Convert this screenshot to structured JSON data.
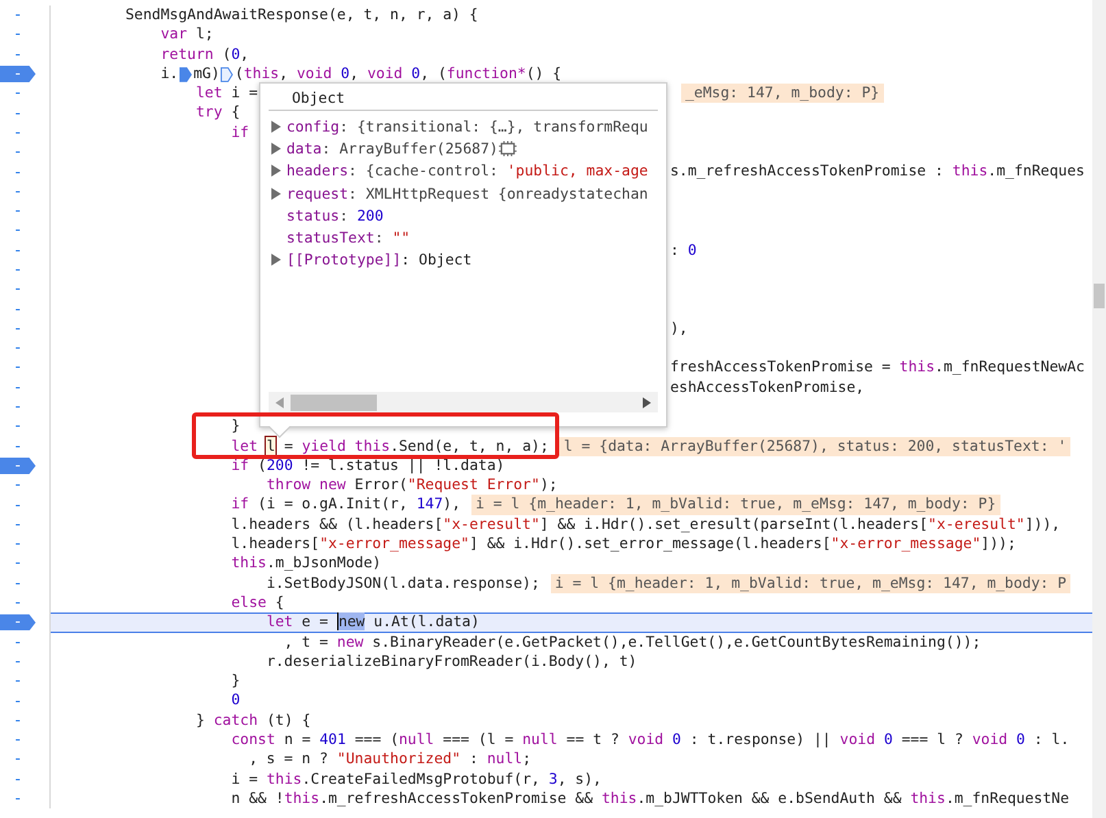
{
  "lines": [
    {
      "gutter": "-",
      "breakpoint": false,
      "current": false,
      "pieces": [
        {
          "kind": "code",
          "tokens": [
            "        SendMsgAndAwaitResponse(e, t, n, r, a) {"
          ]
        }
      ]
    },
    {
      "gutter": "-",
      "breakpoint": false,
      "current": false,
      "pieces": [
        {
          "kind": "code",
          "tokens": [
            {
              "text": "            var",
              "kind": "kw"
            },
            " l;"
          ]
        }
      ]
    },
    {
      "gutter": "-",
      "breakpoint": false,
      "current": false,
      "pieces": [
        {
          "kind": "code",
          "tokens": [
            {
              "text": "            return",
              "kind": "kw"
            },
            " (",
            {
              "text": "0",
              "kind": "num"
            },
            ","
          ]
        }
      ]
    },
    {
      "gutter": "-",
      "breakpoint": true,
      "current": false,
      "pieces": [
        {
          "kind": "code",
          "tokens": [
            "            i."
          ]
        },
        {
          "kind": "mark-solid"
        },
        {
          "kind": "code",
          "tokens": [
            "mG)"
          ]
        },
        {
          "kind": "mark-outline"
        },
        {
          "kind": "code",
          "tokens": [
            "(",
            {
              "text": "this",
              "kind": "kw"
            },
            ", ",
            {
              "text": "void ",
              "kind": "kw"
            },
            {
              "text": "0",
              "kind": "num"
            },
            ", ",
            {
              "text": "void ",
              "kind": "kw"
            },
            {
              "text": "0",
              "kind": "num"
            },
            ", (",
            {
              "text": "function*",
              "kind": "kw"
            },
            "() {"
          ]
        }
      ]
    },
    {
      "gutter": "-",
      "breakpoint": false,
      "current": false,
      "pieces": [
        {
          "kind": "code",
          "tokens": [
            {
              "text": "                let",
              "kind": "kw"
            },
            " i ="
          ]
        }
      ],
      "right": [
        {
          "kind": "value",
          "text": "_eMsg: 147, m_body: P}"
        }
      ]
    },
    {
      "gutter": "-",
      "breakpoint": false,
      "current": false,
      "pieces": [
        {
          "kind": "code",
          "tokens": [
            {
              "text": "                try",
              "kind": "kw"
            },
            " {"
          ]
        }
      ]
    },
    {
      "gutter": "-",
      "breakpoint": false,
      "current": false,
      "pieces": [
        {
          "kind": "code",
          "tokens": [
            {
              "text": "                    if",
              "kind": "kw"
            }
          ]
        }
      ]
    },
    {
      "gutter": "-",
      "breakpoint": false,
      "current": false
    },
    {
      "gutter": "-",
      "breakpoint": false,
      "current": false,
      "right": [
        {
          "kind": "code",
          "tokens": [
            "s.m_refreshAccessTokenPromise : ",
            {
              "text": "this",
              "kind": "kw"
            },
            ".m_fnReques"
          ]
        }
      ]
    },
    {
      "gutter": "-",
      "breakpoint": false,
      "current": false
    },
    {
      "gutter": "-",
      "breakpoint": false,
      "current": false
    },
    {
      "gutter": "-",
      "breakpoint": false,
      "current": false
    },
    {
      "gutter": "-",
      "breakpoint": false,
      "current": false,
      "right": [
        {
          "kind": "code",
          "tokens": [
            ": ",
            {
              "text": "0",
              "kind": "num"
            }
          ]
        }
      ]
    },
    {
      "gutter": "-",
      "breakpoint": false,
      "current": false
    },
    {
      "gutter": "-",
      "breakpoint": false,
      "current": false
    },
    {
      "gutter": "-",
      "breakpoint": false,
      "current": false
    },
    {
      "gutter": "-",
      "breakpoint": false,
      "current": false,
      "right": [
        {
          "kind": "code",
          "tokens": [
            "),"
          ]
        }
      ]
    },
    {
      "gutter": "-",
      "breakpoint": false,
      "current": false
    },
    {
      "gutter": "-",
      "breakpoint": false,
      "current": false,
      "right": [
        {
          "kind": "code",
          "tokens": [
            "freshAccessTokenPromise = ",
            {
              "text": "this",
              "kind": "kw"
            },
            ".m_fnRequestNewAc"
          ]
        }
      ]
    },
    {
      "gutter": "-",
      "breakpoint": false,
      "current": false,
      "right": [
        {
          "kind": "code",
          "tokens": [
            "eshAccessTokenPromise,"
          ]
        }
      ]
    },
    {
      "gutter": "-",
      "breakpoint": false,
      "current": false
    },
    {
      "gutter": "-",
      "breakpoint": false,
      "current": false,
      "pieces": [
        {
          "kind": "code",
          "tokens": [
            "                    }"
          ]
        }
      ]
    },
    {
      "gutter": "-",
      "breakpoint": false,
      "current": false,
      "pieces": [
        {
          "kind": "code",
          "tokens": [
            {
              "text": "                    let ",
              "kind": "kw"
            },
            {
              "text": "l",
              "kind": "boxed"
            },
            " = ",
            {
              "text": "yield this",
              "kind": "kw"
            },
            ".Send(e, t, n, a);"
          ]
        },
        {
          "kind": "value",
          "text": "l = {data: ArrayBuffer(25687), status: 200, statusText: '"
        }
      ]
    },
    {
      "gutter": "-",
      "breakpoint": true,
      "current": false,
      "pieces": [
        {
          "kind": "code",
          "tokens": [
            {
              "text": "                    if",
              "kind": "kw"
            },
            " (",
            {
              "text": "200",
              "kind": "num"
            },
            " != l.status || !l.data)"
          ]
        }
      ]
    },
    {
      "gutter": "-",
      "breakpoint": false,
      "current": false,
      "pieces": [
        {
          "kind": "code",
          "tokens": [
            {
              "text": "                        throw new",
              "kind": "kw"
            },
            " Error(",
            {
              "text": "\"Request Error\"",
              "kind": "str"
            },
            ");"
          ]
        }
      ]
    },
    {
      "gutter": "-",
      "breakpoint": false,
      "current": false,
      "pieces": [
        {
          "kind": "code",
          "tokens": [
            {
              "text": "                    if",
              "kind": "kw"
            },
            " (i = o.gA.Init(r, ",
            {
              "text": "147",
              "kind": "num"
            },
            "),"
          ]
        },
        {
          "kind": "value",
          "text": "i = l {m_header: 1, m_bValid: true, m_eMsg: 147, m_body: P}"
        }
      ]
    },
    {
      "gutter": "-",
      "breakpoint": false,
      "current": false,
      "pieces": [
        {
          "kind": "code",
          "tokens": [
            "                    l.headers && (l.headers[",
            {
              "text": "\"x-eresult\"",
              "kind": "str"
            },
            "] && i.Hdr().set_eresult(parseInt(l.headers[",
            {
              "text": "\"x-eresult\"",
              "kind": "str"
            },
            "])),"
          ]
        }
      ]
    },
    {
      "gutter": "-",
      "breakpoint": false,
      "current": false,
      "pieces": [
        {
          "kind": "code",
          "tokens": [
            "                    l.headers[",
            {
              "text": "\"x-error_message\"",
              "kind": "str"
            },
            "] && i.Hdr().set_error_message(l.headers[",
            {
              "text": "\"x-error_message\"",
              "kind": "str"
            },
            "]));"
          ]
        }
      ]
    },
    {
      "gutter": "-",
      "breakpoint": false,
      "current": false,
      "pieces": [
        {
          "kind": "code",
          "tokens": [
            {
              "text": "                    this",
              "kind": "kw"
            },
            ".m_bJsonMode)"
          ]
        }
      ]
    },
    {
      "gutter": "-",
      "breakpoint": false,
      "current": false,
      "pieces": [
        {
          "kind": "code",
          "tokens": [
            "                        i.SetBodyJSON(l.data.response);"
          ]
        },
        {
          "kind": "value",
          "text": "i = l {m_header: 1, m_bValid: true, m_eMsg: 147, m_body: P"
        }
      ]
    },
    {
      "gutter": "-",
      "breakpoint": false,
      "current": false,
      "pieces": [
        {
          "kind": "code",
          "tokens": [
            {
              "text": "                    else",
              "kind": "kw"
            },
            " {"
          ]
        }
      ]
    },
    {
      "gutter": "-",
      "breakpoint": true,
      "current": true,
      "pieces": [
        {
          "kind": "code",
          "tokens": [
            {
              "text": "                        let",
              "kind": "kw"
            },
            " e = ",
            {
              "text": "new",
              "kind": "sel"
            },
            " u.At(l.data)"
          ]
        }
      ]
    },
    {
      "gutter": "-",
      "breakpoint": false,
      "current": false,
      "pieces": [
        {
          "kind": "code",
          "tokens": [
            "                          , t = ",
            {
              "text": "new",
              "kind": "kw"
            },
            " s.BinaryReader(e.GetPacket(),e.TellGet(),e.GetCountBytesRemaining());"
          ]
        }
      ]
    },
    {
      "gutter": "-",
      "breakpoint": false,
      "current": false,
      "pieces": [
        {
          "kind": "code",
          "tokens": [
            "                        r.deserializeBinaryFromReader(i.Body(), t)"
          ]
        }
      ]
    },
    {
      "gutter": "-",
      "breakpoint": false,
      "current": false,
      "pieces": [
        {
          "kind": "code",
          "tokens": [
            "                    }"
          ]
        }
      ]
    },
    {
      "gutter": "-",
      "breakpoint": false,
      "current": false,
      "pieces": [
        {
          "kind": "code",
          "tokens": [
            {
              "text": "                    0",
              "kind": "num"
            }
          ]
        }
      ]
    },
    {
      "gutter": "-",
      "breakpoint": false,
      "current": false,
      "pieces": [
        {
          "kind": "code",
          "tokens": [
            "                } ",
            {
              "text": "catch",
              "kind": "kw"
            },
            " (t) {"
          ]
        }
      ]
    },
    {
      "gutter": "-",
      "breakpoint": false,
      "current": false,
      "pieces": [
        {
          "kind": "code",
          "tokens": [
            {
              "text": "                    const",
              "kind": "kw"
            },
            " n = ",
            {
              "text": "401",
              "kind": "num"
            },
            " === (",
            {
              "text": "null",
              "kind": "kw"
            },
            " === (l = ",
            {
              "text": "null",
              "kind": "kw"
            },
            " == t ? ",
            {
              "text": "void ",
              "kind": "kw"
            },
            {
              "text": "0",
              "kind": "num"
            },
            " : t.response) || ",
            {
              "text": "void ",
              "kind": "kw"
            },
            {
              "text": "0",
              "kind": "num"
            },
            " === l ? ",
            {
              "text": "void ",
              "kind": "kw"
            },
            {
              "text": "0",
              "kind": "num"
            },
            " : l."
          ]
        }
      ]
    },
    {
      "gutter": "-",
      "breakpoint": false,
      "current": false,
      "pieces": [
        {
          "kind": "code",
          "tokens": [
            "                      , s = n ? ",
            {
              "text": "\"Unauthorized\"",
              "kind": "str"
            },
            " : ",
            {
              "text": "null",
              "kind": "kw"
            },
            ";"
          ]
        }
      ]
    },
    {
      "gutter": "-",
      "breakpoint": false,
      "current": false,
      "pieces": [
        {
          "kind": "code",
          "tokens": [
            "                    i = ",
            {
              "text": "this",
              "kind": "kw"
            },
            ".CreateFailedMsgProtobuf(r, ",
            {
              "text": "3",
              "kind": "num"
            },
            ", s),"
          ]
        }
      ]
    },
    {
      "gutter": "-",
      "breakpoint": false,
      "current": false,
      "pieces": [
        {
          "kind": "code",
          "tokens": [
            "                    n && !",
            {
              "text": "this",
              "kind": "kw"
            },
            ".m_refreshAccessTokenPromise && ",
            {
              "text": "this",
              "kind": "kw"
            },
            ".m_bJWTToken && e.bSendAuth && ",
            {
              "text": "this",
              "kind": "kw"
            },
            ".m_fnRequestNe"
          ]
        }
      ]
    }
  ],
  "popover": {
    "title": "Object",
    "properties": [
      {
        "kind": "object",
        "expandable": true,
        "key": "config",
        "value": [
          {
            "text": ": {transitional: {…}, transformRequ",
            "kind": "obj"
          }
        ]
      },
      {
        "kind": "buffer",
        "expandable": true,
        "key": "data",
        "value": [
          {
            "text": ": ArrayBuffer(25687)",
            "kind": "obj"
          }
        ]
      },
      {
        "kind": "object",
        "expandable": true,
        "key": "headers",
        "value": [
          {
            "text": ": {cache-control: ",
            "kind": "obj"
          },
          {
            "text": "'public, max-age",
            "kind": "str"
          }
        ]
      },
      {
        "kind": "object",
        "expandable": true,
        "key": "request",
        "value": [
          {
            "text": ": XMLHttpRequest {onreadystatechan",
            "kind": "obj"
          }
        ]
      },
      {
        "kind": "value",
        "expandable": false,
        "key": "status",
        "value": [
          {
            "text": ": ",
            "kind": "obj"
          },
          {
            "text": "200",
            "kind": "num"
          }
        ]
      },
      {
        "kind": "value",
        "expandable": false,
        "key": "statusText",
        "value": [
          {
            "text": ": ",
            "kind": "obj"
          },
          {
            "text": "\"\"",
            "kind": "str"
          }
        ]
      },
      {
        "kind": "object",
        "expandable": true,
        "key": "[[Prototype]]",
        "value": [
          {
            "text": ": Object",
            "kind": "plain"
          }
        ]
      }
    ]
  }
}
